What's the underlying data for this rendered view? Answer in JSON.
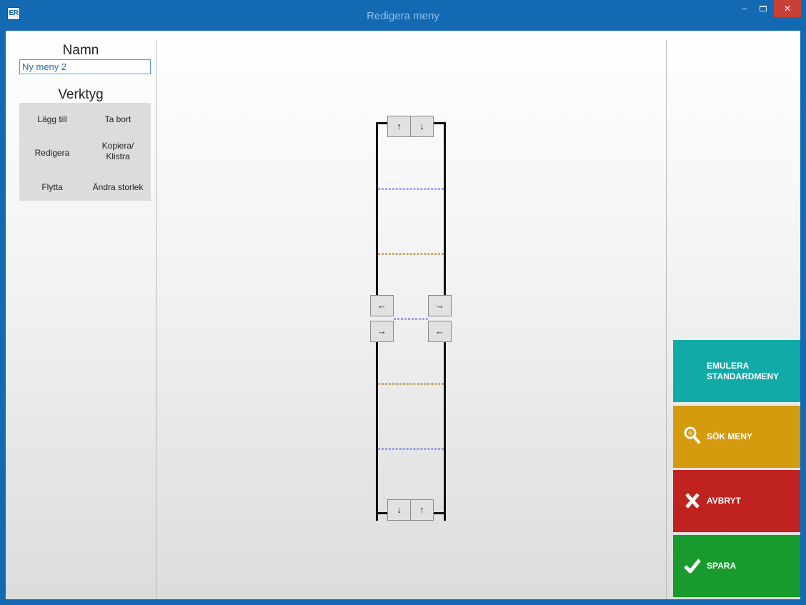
{
  "window": {
    "app_icon_text": "ER",
    "title": "Redigera meny",
    "minimize_glyph": "–",
    "close_glyph": "✕"
  },
  "left_panel": {
    "name_heading": "Namn",
    "name_value": "Ny meny 2",
    "tools_heading": "Verktyg",
    "tools": {
      "add": "Lägg till",
      "remove": "Ta bort",
      "edit": "Redigera",
      "copy_line1": "Kopiera/",
      "copy_line2": "Klistra",
      "move": "Flytta",
      "resize": "Ändra storlek"
    }
  },
  "editor": {
    "top_up": "↑",
    "top_down": "↓",
    "bottom_down": "↓",
    "bottom_up": "↑",
    "left_top": "←",
    "left_bottom": "→",
    "right_top": "→",
    "right_bottom": "←"
  },
  "actions": {
    "emulate_line1": "EMULERA",
    "emulate_line2": "STANDARDMENY",
    "search": "SÖK MENY",
    "cancel": "AVBRYT",
    "save": "SPARA"
  },
  "colors": {
    "title_bar": "#1469b3",
    "emulate": "#12aaa6",
    "search": "#d39b0d",
    "cancel": "#c0221f",
    "save": "#189a2c"
  },
  "icons": {
    "search": "magnifier-icon",
    "cancel": "x-icon",
    "save": "checkmark-icon"
  }
}
